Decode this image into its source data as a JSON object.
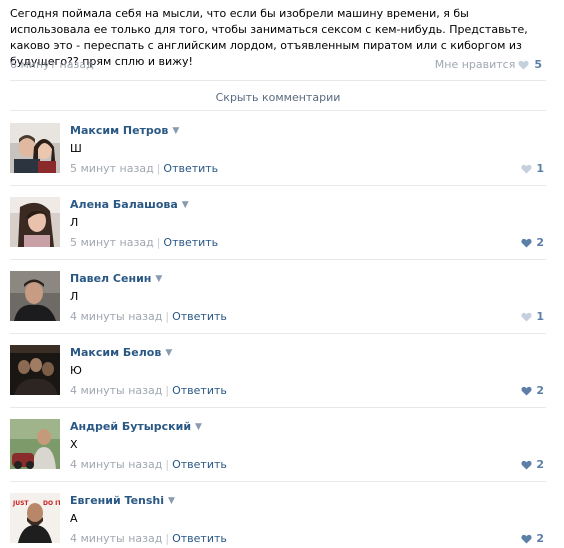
{
  "post": {
    "text": "Сегодня поймала себя на мысли, что если бы изобрели машину времени, я бы использовала ее только для того, чтобы заниматься сексом с кем-нибудь. Представьте, каково это - переспать с английским лордом, отъявленным пиратом или с киборгом из будущего?? прям сплю и вижу!",
    "time": "6 минут назад",
    "like_label": "Мне нравится",
    "like_count": "5"
  },
  "hide_comments_label": "Скрыть комментарии",
  "reply_label": "Ответить",
  "colors": {
    "link": "#2a5885",
    "muted": "#a0a7b1",
    "heart_active": "#5b7fa6",
    "heart_inactive": "#c4d0dd"
  },
  "comments": [
    {
      "author": "Максим Петров",
      "text": "Ш",
      "time": "5 минут назад",
      "likes": "1",
      "heart": "inactive"
    },
    {
      "author": "Алена Балашова",
      "text": "Л",
      "time": "5 минут назад",
      "likes": "2",
      "heart": "active"
    },
    {
      "author": "Павел Сенин",
      "text": "Л",
      "time": "4 минуты назад",
      "likes": "1",
      "heart": "inactive"
    },
    {
      "author": "Максим Белов",
      "text": "Ю",
      "time": "4 минуты назад",
      "likes": "2",
      "heart": "active"
    },
    {
      "author": "Андрей Бутырский",
      "text": "Х",
      "time": "4 минуты назад",
      "likes": "2",
      "heart": "active"
    },
    {
      "author": "Евгений Tenshi",
      "text": "А",
      "time": "4 минуты назад",
      "likes": "2",
      "heart": "active"
    }
  ],
  "avatar_6_text": [
    "JUST",
    "DO IT"
  ]
}
